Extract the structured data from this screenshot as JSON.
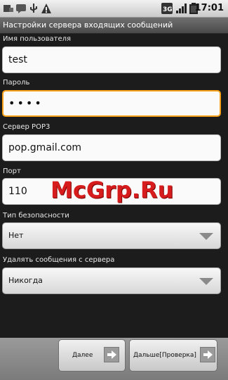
{
  "status_bar": {
    "time": "17:01",
    "left_icons": [
      "settings-icon",
      "chat-icon",
      "usb-icon",
      "warning-icon"
    ],
    "right_icons": [
      "3g-icon",
      "signal-icon",
      "battery-icon"
    ]
  },
  "title": "Настройки сервера входящих сообщений",
  "form": {
    "username_label": "Имя пользователя",
    "username_value": "test",
    "password_label": "Пароль",
    "password_value": "••••",
    "server_label": "Сервер POP3",
    "server_value": "pop.gmail.com",
    "port_label": "Порт",
    "port_value": "110",
    "security_label": "Тип безопасности",
    "security_value": "Нет",
    "delete_label": "Удалять сообщения с сервера",
    "delete_value": "Никогда"
  },
  "buttons": {
    "next_label": "Далее",
    "next_check_label": "Дальше[Проверка]"
  },
  "watermark": "McGrp.Ru",
  "colors": {
    "focus_border": "#f7a21a",
    "watermark": "#d61c1c"
  }
}
